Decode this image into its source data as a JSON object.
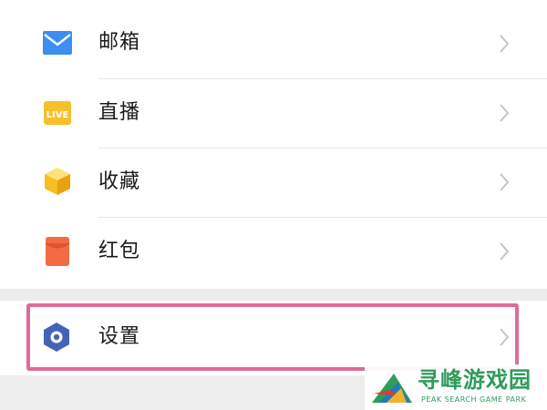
{
  "menu": {
    "items": [
      {
        "label": "邮箱",
        "icon": "mail-icon",
        "color": "#3d8ef0"
      },
      {
        "label": "直播",
        "icon": "live-icon",
        "color": "#f6c02c",
        "icon_text": "LIVE"
      },
      {
        "label": "收藏",
        "icon": "favorites-cube-icon",
        "color": "#f7bd21"
      },
      {
        "label": "红包",
        "icon": "red-envelope-icon",
        "color": "#f26b45"
      }
    ],
    "settings": {
      "label": "设置",
      "icon": "settings-hexagon-icon",
      "color": "#4463b8"
    }
  },
  "highlight_color": "#e06a9a",
  "watermark": {
    "title": "寻峰游戏园",
    "subtitle": "PEAK SEARCH GAME PARK",
    "color": "#2e9c5a"
  }
}
